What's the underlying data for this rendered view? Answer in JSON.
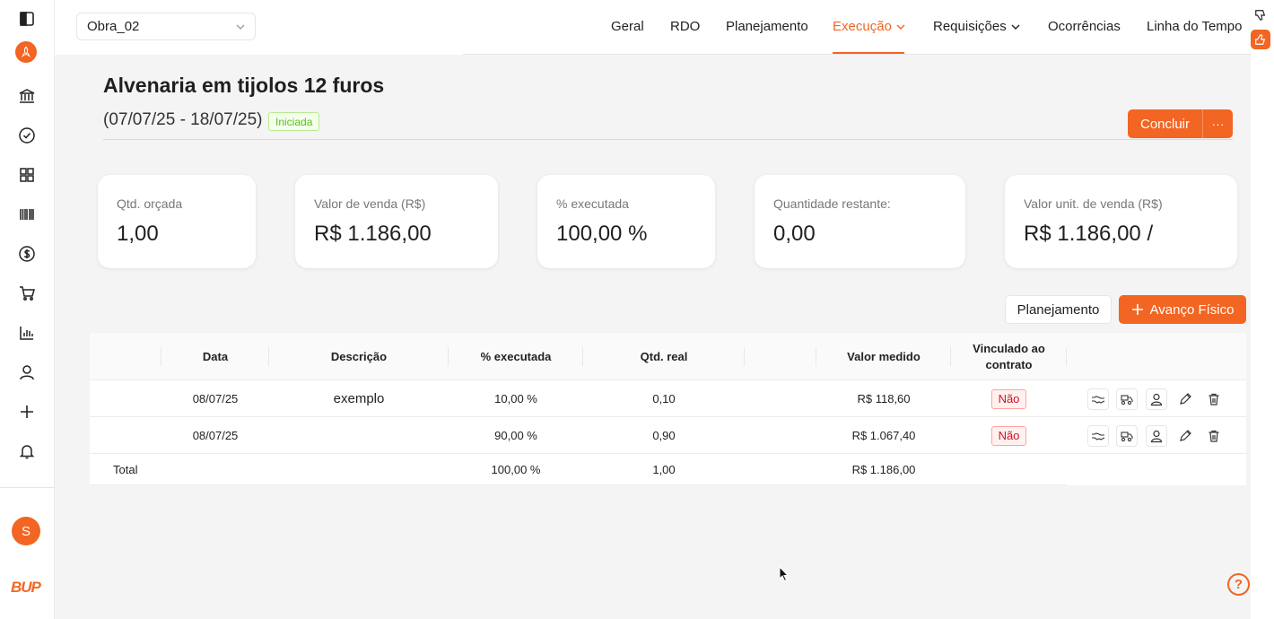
{
  "header": {
    "project": "Obra_02",
    "nav": [
      {
        "label": "Geral",
        "active": false,
        "dropdown": false
      },
      {
        "label": "RDO",
        "active": false,
        "dropdown": false
      },
      {
        "label": "Planejamento",
        "active": false,
        "dropdown": false
      },
      {
        "label": "Execução",
        "active": true,
        "dropdown": true
      },
      {
        "label": "Requisições",
        "active": false,
        "dropdown": true
      },
      {
        "label": "Ocorrências",
        "active": false,
        "dropdown": false
      },
      {
        "label": "Linha do Tempo",
        "active": false,
        "dropdown": false
      }
    ]
  },
  "sidebar": {
    "icons": [
      "panel-toggle-icon",
      "rocket-logo-icon",
      "bank-icon",
      "check-circle-icon",
      "grid-icon",
      "barcode-icon",
      "dollar-icon",
      "cart-icon",
      "bar-chart-icon",
      "user-icon",
      "plus-icon",
      "bell-icon"
    ],
    "avatar": "S",
    "brand": "BUP"
  },
  "page": {
    "title": "Alvenaria em tijolos 12 furos",
    "dates": "(07/07/25 - 18/07/25)",
    "status": "Iniciada",
    "conclude_label": "Concluir",
    "more_label": "···"
  },
  "cards": [
    {
      "label": "Qtd. orçada",
      "value": "1,00"
    },
    {
      "label": "Valor de venda (R$)",
      "value": "R$ 1.186,00"
    },
    {
      "label": "% executada",
      "value": "100,00 %"
    },
    {
      "label": "Quantidade restante:",
      "value": "0,00"
    },
    {
      "label": "Valor unit. de venda (R$)",
      "value": "R$ 1.186,00 /"
    }
  ],
  "actions": {
    "planejamento": "Planejamento",
    "avanco": "Avanço Físico"
  },
  "table": {
    "columns": [
      "Data",
      "Descrição",
      "% executada",
      "Qtd. real",
      "Valor medido",
      "Vinculado ao contrato"
    ],
    "rows": [
      {
        "data": "08/07/25",
        "descricao": "exemplo",
        "executada": "10,00 %",
        "qtd": "0,10",
        "valor": "R$ 118,60",
        "vinculado": "Não"
      },
      {
        "data": "08/07/25",
        "descricao": "",
        "executada": "90,00 %",
        "qtd": "0,90",
        "valor": "R$ 1.067,40",
        "vinculado": "Não"
      }
    ],
    "total": {
      "label": "Total",
      "executada": "100,00 %",
      "qtd": "1,00",
      "valor": "R$ 1.186,00"
    }
  },
  "help": "?",
  "colors": {
    "accent": "#f26522",
    "success": "#52c41a",
    "danger": "#cf1322"
  }
}
